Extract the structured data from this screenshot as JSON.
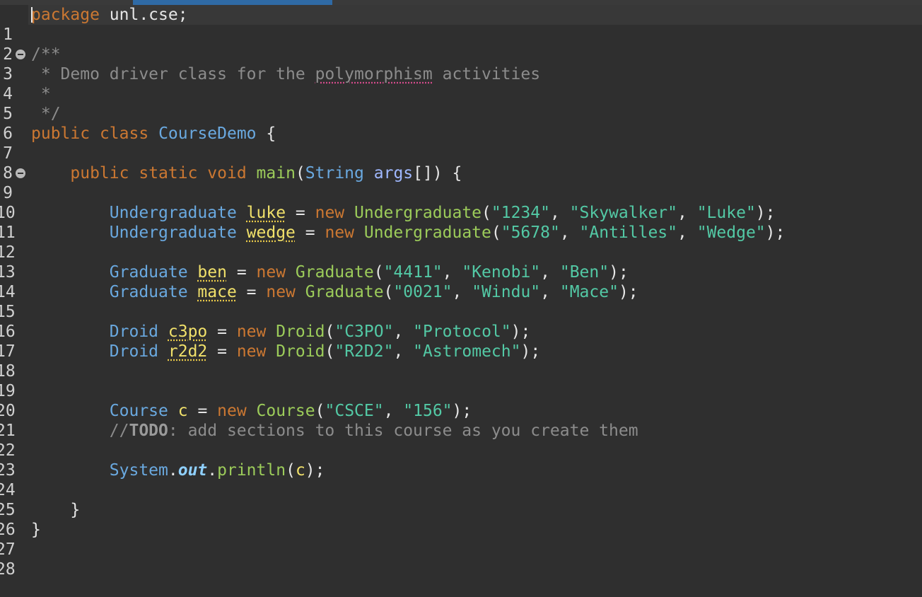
{
  "line_numbers": [
    "1",
    "2",
    "3",
    "4",
    "5",
    "6",
    "7",
    "8",
    "9",
    "10",
    "11",
    "12",
    "13",
    "14",
    "15",
    "16",
    "17",
    "18",
    "19",
    "20",
    "21",
    "22",
    "23",
    "24",
    "25",
    "26",
    "27",
    "28"
  ],
  "code": {
    "l1": {
      "kw": "package",
      "rest": " unl.cse;"
    },
    "l3": {
      "text": "/**"
    },
    "l4": {
      "pre": " * Demo driver class for the ",
      "spell": "polymorphism",
      "post": " activities"
    },
    "l5": {
      "text": " *"
    },
    "l6": {
      "text": " */"
    },
    "l7": {
      "kw1": "public",
      "kw2": "class",
      "name": "CourseDemo",
      "brace": " {"
    },
    "l9": {
      "kw1": "public",
      "kw2": "static",
      "kw3": "void",
      "method": "main",
      "open": "(",
      "type": "String",
      "param": "args",
      "close": "[]) {"
    },
    "l11": {
      "type": "Undergraduate",
      "var": "luke",
      "eq": " = ",
      "kw": "new",
      "ctor": "Undergraduate",
      "p1": "(",
      "a1": "\"1234\"",
      "c1": ", ",
      "a2": "\"Skywalker\"",
      "c2": ", ",
      "a3": "\"Luke\"",
      "end": ");"
    },
    "l12": {
      "type": "Undergraduate",
      "var": "wedge",
      "eq": " = ",
      "kw": "new",
      "ctor": "Undergraduate",
      "p1": "(",
      "a1": "\"5678\"",
      "c1": ", ",
      "a2": "\"Antilles\"",
      "c2": ", ",
      "a3": "\"Wedge\"",
      "end": ");"
    },
    "l14": {
      "type": "Graduate",
      "var": "ben",
      "eq": " = ",
      "kw": "new",
      "ctor": "Graduate",
      "p1": "(",
      "a1": "\"4411\"",
      "c1": ", ",
      "a2": "\"Kenobi\"",
      "c2": ", ",
      "a3": "\"Ben\"",
      "end": ");"
    },
    "l15": {
      "type": "Graduate",
      "var": "mace",
      "eq": " = ",
      "kw": "new",
      "ctor": "Graduate",
      "p1": "(",
      "a1": "\"0021\"",
      "c1": ", ",
      "a2": "\"Windu\"",
      "c2": ", ",
      "a3": "\"Mace\"",
      "end": ");"
    },
    "l17": {
      "type": "Droid",
      "var": "c3po",
      "eq": " = ",
      "kw": "new",
      "ctor": "Droid",
      "p1": "(",
      "a1": "\"C3PO\"",
      "c1": ", ",
      "a2": "\"Protocol\"",
      "end": ");"
    },
    "l18": {
      "type": "Droid",
      "var": "r2d2",
      "eq": " = ",
      "kw": "new",
      "ctor": "Droid",
      "p1": "(",
      "a1": "\"R2D2\"",
      "c1": ", ",
      "a2": "\"Astromech\"",
      "end": ");"
    },
    "l21": {
      "type": "Course",
      "var": "c",
      "eq": " = ",
      "kw": "new",
      "ctor": "Course",
      "p1": "(",
      "a1": "\"CSCE\"",
      "c1": ", ",
      "a2": "\"156\"",
      "end": ");"
    },
    "l22": {
      "slashes": "//",
      "todo": "TODO",
      "rest": ": add sections to this course as you create them"
    },
    "l24": {
      "cls": "System",
      "dot1": ".",
      "field": "out",
      "dot2": ".",
      "method": "println",
      "open": "(",
      "arg": "c",
      "end": ");"
    },
    "l26": {
      "text": "}"
    },
    "l27": {
      "text": "}"
    }
  },
  "colors": {
    "background": "#2f2f2f",
    "keyword": "#cc7832",
    "type": "#6aa9e0",
    "string": "#53c9a5",
    "method": "#9ccc5a",
    "comment": "#8c8c8c",
    "local_variable": "#f0e06a"
  }
}
